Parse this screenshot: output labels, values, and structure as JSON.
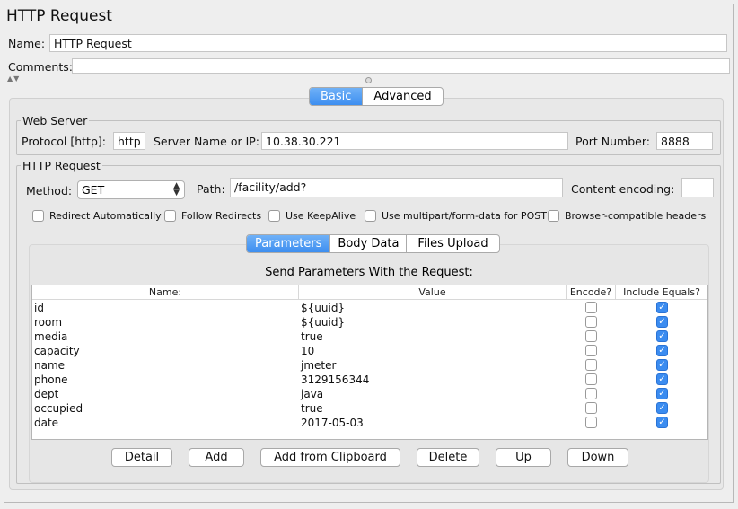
{
  "panel_title": "HTTP Request",
  "name_label": "Name:",
  "name_value": "HTTP Request",
  "comments_label": "Comments:",
  "comments_value": "",
  "mode_tabs": [
    "Basic",
    "Advanced"
  ],
  "web_server": {
    "legend": "Web Server",
    "protocol_label": "Protocol [http]:",
    "protocol_value": "http",
    "server_label": "Server Name or IP:",
    "server_value": "10.38.30.221",
    "port_label": "Port Number:",
    "port_value": "8888"
  },
  "http_request": {
    "legend": "HTTP Request",
    "method_label": "Method:",
    "method_value": "GET",
    "path_label": "Path:",
    "path_value": "/facility/add?",
    "encoding_label": "Content encoding:",
    "encoding_value": "",
    "options": [
      {
        "label": "Redirect Automatically",
        "checked": false
      },
      {
        "label": "Follow Redirects",
        "checked": false
      },
      {
        "label": "Use KeepAlive",
        "checked": false
      },
      {
        "label": "Use multipart/form-data for POST",
        "checked": false
      },
      {
        "label": "Browser-compatible headers",
        "checked": false
      }
    ]
  },
  "param_tabs": [
    "Parameters",
    "Body Data",
    "Files Upload"
  ],
  "table": {
    "caption": "Send Parameters With the Request:",
    "columns": [
      "Name:",
      "Value",
      "Encode?",
      "Include Equals?"
    ],
    "rows": [
      {
        "name": "id",
        "value": "${uuid}",
        "encode": false,
        "include_equals": true
      },
      {
        "name": "room",
        "value": "${uuid}",
        "encode": false,
        "include_equals": true
      },
      {
        "name": "media",
        "value": "true",
        "encode": false,
        "include_equals": true
      },
      {
        "name": "capacity",
        "value": "10",
        "encode": false,
        "include_equals": true
      },
      {
        "name": "name",
        "value": "jmeter",
        "encode": false,
        "include_equals": true
      },
      {
        "name": "phone",
        "value": "3129156344",
        "encode": false,
        "include_equals": true
      },
      {
        "name": "dept",
        "value": "java",
        "encode": false,
        "include_equals": true
      },
      {
        "name": "occupied",
        "value": "true",
        "encode": false,
        "include_equals": true
      },
      {
        "name": "date",
        "value": "2017-05-03",
        "encode": false,
        "include_equals": true
      }
    ]
  },
  "buttons": [
    "Detail",
    "Add",
    "Add from Clipboard",
    "Delete",
    "Up",
    "Down"
  ],
  "colors": {
    "accent": "#3d8ef0",
    "background": "#eeeeee"
  }
}
